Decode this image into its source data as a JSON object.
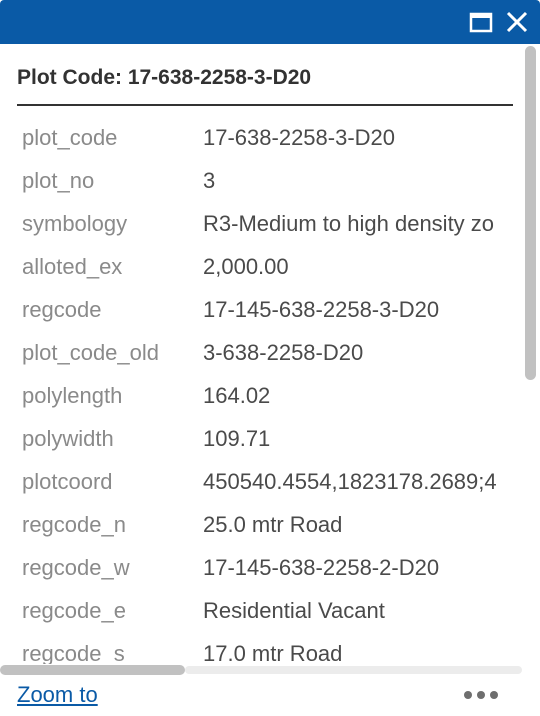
{
  "window": {
    "maximize_icon": "maximize-icon",
    "close_icon": "close-icon",
    "titlebar_color": "#0a5aa6"
  },
  "popup": {
    "title": "Plot Code: 17-638-2258-3-D20",
    "attributes": [
      {
        "name": "plot_code",
        "value": "17-638-2258-3-D20"
      },
      {
        "name": "plot_no",
        "value": "3"
      },
      {
        "name": "symbology",
        "value": "R3-Medium to high density zo"
      },
      {
        "name": "alloted_ex",
        "value": "2,000.00"
      },
      {
        "name": "regcode",
        "value": "17-145-638-2258-3-D20"
      },
      {
        "name": "plot_code_old",
        "value": "3-638-2258-D20"
      },
      {
        "name": "polylength",
        "value": "164.02"
      },
      {
        "name": "polywidth",
        "value": "109.71"
      },
      {
        "name": "plotcoord",
        "value": "450540.4554,1823178.2689;4"
      },
      {
        "name": "regcode_n",
        "value": "25.0 mtr Road"
      },
      {
        "name": "regcode_w",
        "value": "17-145-638-2258-2-D20"
      },
      {
        "name": "regcode_e",
        "value": "Residential Vacant"
      },
      {
        "name": "regcode_s",
        "value": "17.0 mtr Road"
      }
    ]
  },
  "footer": {
    "zoom_label": "Zoom to",
    "more_icon": "ellipsis-icon",
    "link_color": "#0a5aa6"
  }
}
